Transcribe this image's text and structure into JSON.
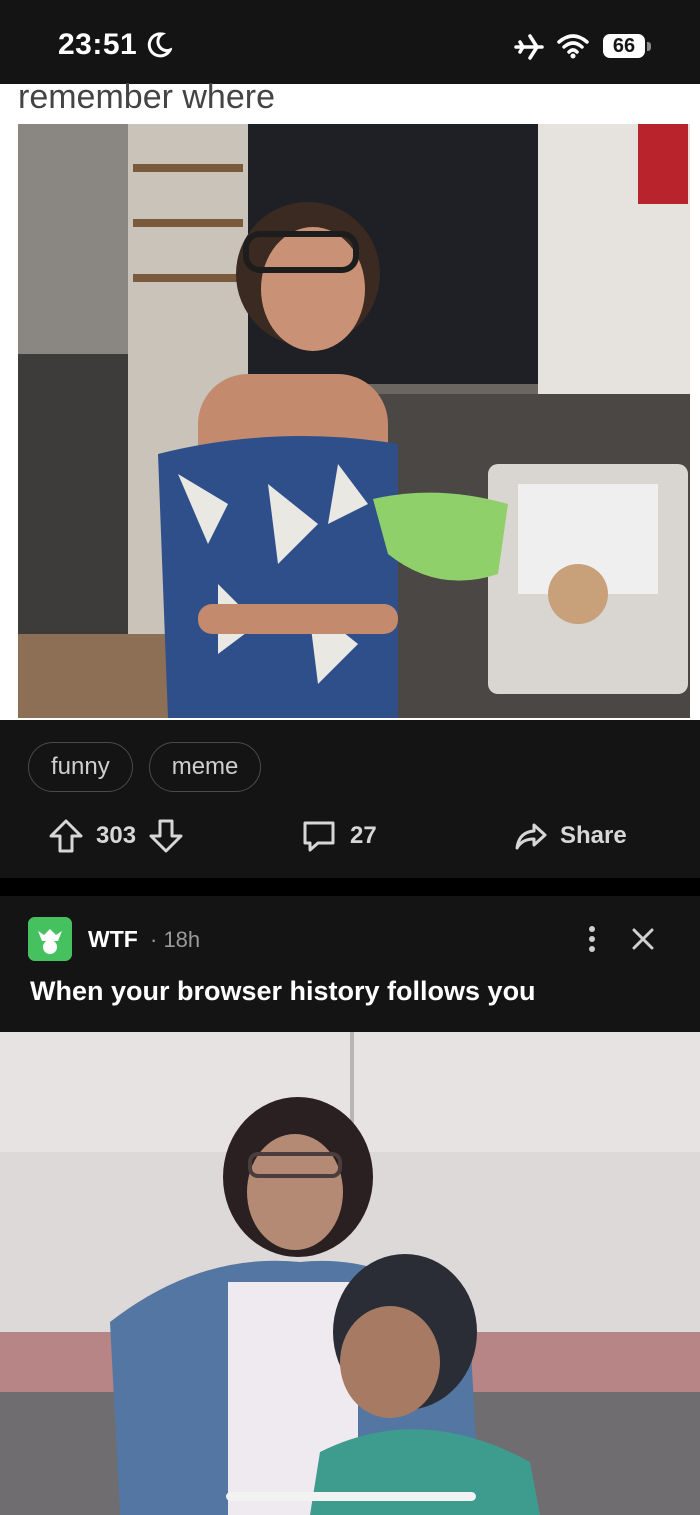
{
  "status_bar": {
    "time": "23:51",
    "battery_level": "66",
    "icons": [
      "moon-icon",
      "airplane-icon",
      "wifi-icon",
      "battery-icon"
    ]
  },
  "post1": {
    "image_caption_text": "remember where",
    "tags": [
      "funny",
      "meme"
    ],
    "upvotes": "303",
    "comments": "27",
    "share_label": "Share"
  },
  "post2": {
    "subreddit": "WTF",
    "time_ago": "· 18h",
    "title": "When your browser history follows you"
  },
  "colors": {
    "background": "#141414",
    "subreddit_icon": "#46c15f",
    "text": "#e8e8e8"
  }
}
